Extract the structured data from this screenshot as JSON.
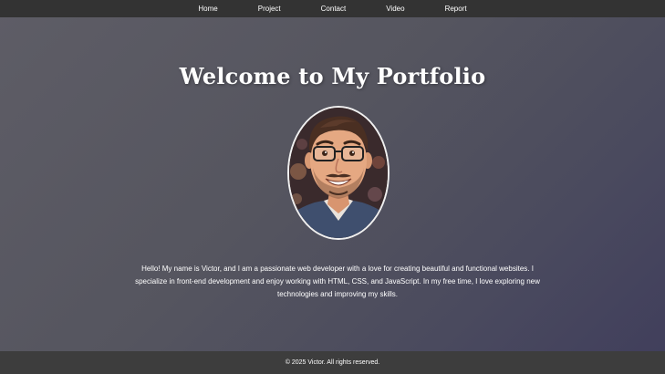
{
  "nav": {
    "items": [
      {
        "label": "Home"
      },
      {
        "label": "Project"
      },
      {
        "label": "Contact"
      },
      {
        "label": "Video"
      },
      {
        "label": "Report"
      }
    ]
  },
  "hero": {
    "title": "Welcome to My Portfolio",
    "photo_icon": "avatar-portrait"
  },
  "bio": {
    "text": "Hello! My name is Victor, and I am a passionate web developer with a love for creating beautiful and functional websites. I specialize in front-end development and enjoy working with HTML, CSS, and JavaScript. In my free time, I love exploring new technologies and improving my skills."
  },
  "footer": {
    "copyright": "© 2025 Victor. All rights reserved."
  },
  "colors": {
    "navbar_bg": "#333333",
    "footer_bg": "#3d3d3d",
    "text": "#ffffff"
  }
}
